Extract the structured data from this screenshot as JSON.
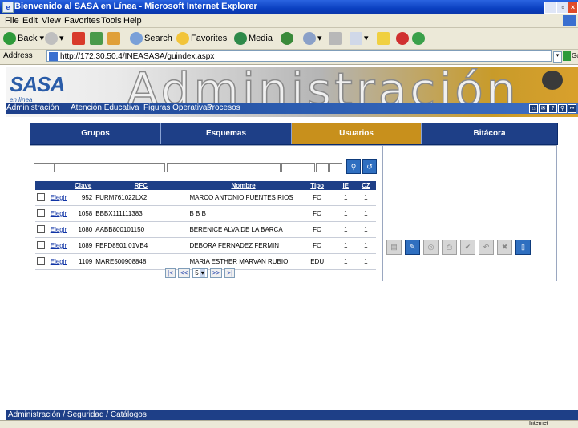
{
  "window": {
    "title": "Bienvenido al SASA en Línea - Microsoft Internet Explorer",
    "minimize": "_",
    "restore": "▫",
    "close": "×"
  },
  "menu": [
    "File",
    "Edit",
    "View",
    "Favorites",
    "Tools",
    "Help"
  ],
  "toolbar": {
    "back": "Back",
    "search": "Search",
    "favorites": "Favorites",
    "media": "Media"
  },
  "address": {
    "label": "Address",
    "url": "http://172.30.50.4/INEASASA/guindex.aspx",
    "go": "Go"
  },
  "banner": {
    "logo": "SASA",
    "logo_sub": "en línea",
    "title": "Administración",
    "nav": [
      "Administración",
      "Atención Educativa",
      "Figuras Operativas",
      "Procesos"
    ]
  },
  "tabs": [
    {
      "label": "Grupos",
      "active": false
    },
    {
      "label": "Esquemas",
      "active": false
    },
    {
      "label": "Usuarios",
      "active": true
    },
    {
      "label": "Bitácora",
      "active": false
    }
  ],
  "table": {
    "headers": [
      "Clave",
      "RFC",
      "Nombre",
      "Tipo",
      "IE",
      "CZ"
    ],
    "link_label": "Elegir",
    "rows": [
      {
        "clave": "952",
        "rfc": "FURM761022LX2",
        "nombre": "MARCO ANTONIO FUENTES RIOS",
        "tipo": "FO",
        "ie": "1",
        "cz": "1"
      },
      {
        "clave": "1058",
        "rfc": "BBBX111111383",
        "nombre": "B B B",
        "tipo": "FO",
        "ie": "1",
        "cz": "1"
      },
      {
        "clave": "1080",
        "rfc": "AABB800101150",
        "nombre": "BERENICE ALVA DE LA BARCA",
        "tipo": "FO",
        "ie": "1",
        "cz": "1"
      },
      {
        "clave": "1089",
        "rfc": "FEFD8501 01VB4",
        "nombre": "DEBORA FERNADEZ FERMIN",
        "tipo": "FO",
        "ie": "1",
        "cz": "1"
      },
      {
        "clave": "1109",
        "rfc": "MARE500908848",
        "nombre": "MARIA ESTHER MARVAN RUBIO",
        "tipo": "EDU",
        "ie": "1",
        "cz": "1"
      }
    ]
  },
  "pager": {
    "first": "|<",
    "prev": "<<",
    "page": "5",
    "next": ">>",
    "last": ">|"
  },
  "footer": "Administración / Seguridad / Catálogos",
  "status": "Internet",
  "colors": {
    "accent": "#1e3f87",
    "active_tab": "#c8901c"
  }
}
